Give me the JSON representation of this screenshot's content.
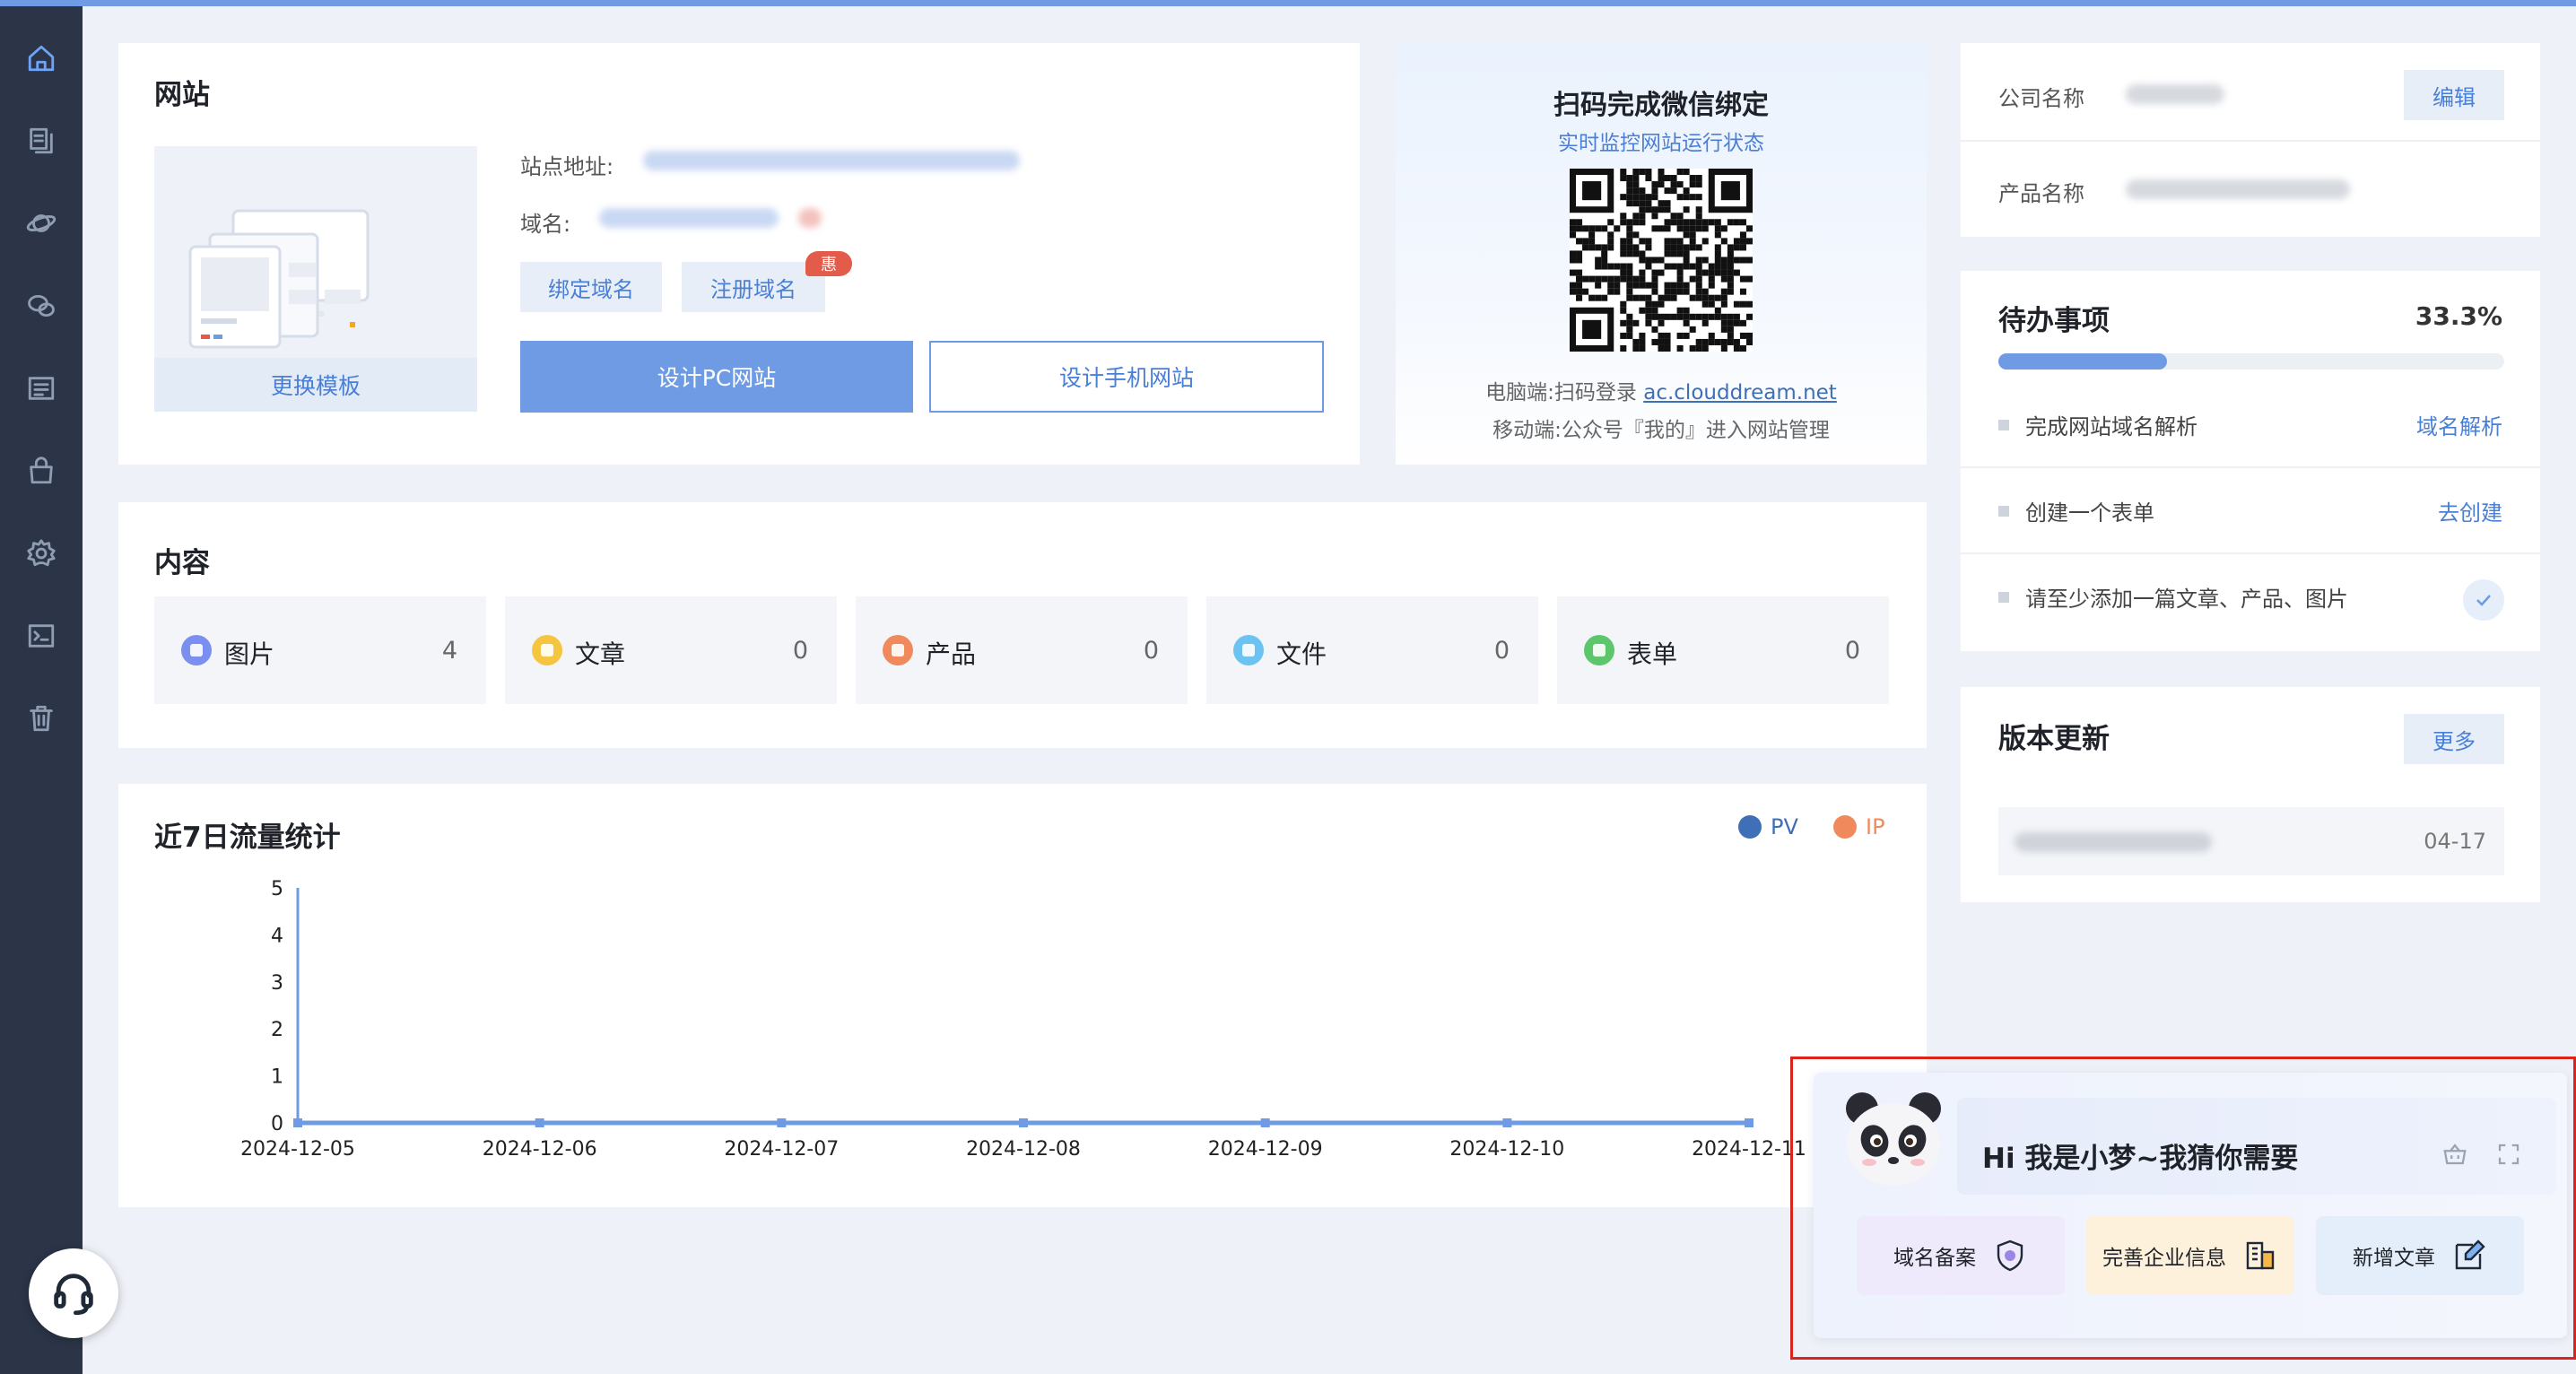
{
  "colors": {
    "accent": "#6e9be4",
    "link": "#4a7fd6",
    "sidebar": "#2b3547",
    "pv": "#3f6fb6",
    "ip": "#f08a5d"
  },
  "sidebar": {
    "items": [
      {
        "icon": "home-icon"
      },
      {
        "icon": "pages-icon"
      },
      {
        "icon": "planet-icon"
      },
      {
        "icon": "wechat-icon"
      },
      {
        "icon": "list-icon"
      },
      {
        "icon": "shop-icon"
      },
      {
        "icon": "gear-icon"
      },
      {
        "icon": "terminal-icon"
      },
      {
        "icon": "trash-icon"
      }
    ]
  },
  "website": {
    "title": "网站",
    "change_template": "更换模板",
    "site_address_label": "站点地址:",
    "domain_label": "域名:",
    "bind_domain": "绑定域名",
    "register_domain": "注册域名",
    "hui_badge": "惠",
    "design_pc": "设计PC网站",
    "design_mobile": "设计手机网站"
  },
  "wechat": {
    "title": "扫码完成微信绑定",
    "subtitle": "实时监控网站运行状态",
    "pc_label": "电脑端:扫码登录",
    "pc_link": "ac.clouddream.net",
    "mobile_label": "移动端:公众号『我的』进入网站管理"
  },
  "content": {
    "title": "内容",
    "tiles": [
      {
        "label": "图片",
        "count": "4",
        "color": "#7a8ff0"
      },
      {
        "label": "文章",
        "count": "0",
        "color": "#f5c542"
      },
      {
        "label": "产品",
        "count": "0",
        "color": "#f08a5d"
      },
      {
        "label": "文件",
        "count": "0",
        "color": "#6cc3f2"
      },
      {
        "label": "表单",
        "count": "0",
        "color": "#5cc76a"
      }
    ]
  },
  "traffic": {
    "title": "近7日流量统计",
    "legend": [
      {
        "name": "PV",
        "color": "#3f6fb6"
      },
      {
        "name": "IP",
        "color": "#f08a5d"
      }
    ]
  },
  "chart_data": {
    "type": "line",
    "title": "近7日流量统计",
    "x": [
      "2024-12-05",
      "2024-12-06",
      "2024-12-07",
      "2024-12-08",
      "2024-12-09",
      "2024-12-10",
      "2024-12-11"
    ],
    "series": [
      {
        "name": "PV",
        "values": [
          0,
          0,
          0,
          0,
          0,
          0,
          0
        ]
      },
      {
        "name": "IP",
        "values": [
          0,
          0,
          0,
          0,
          0,
          0,
          0
        ]
      }
    ],
    "yticks": [
      "0",
      "1",
      "2",
      "3",
      "4",
      "5"
    ],
    "ylim": [
      0,
      5
    ],
    "legend_position": "top-right"
  },
  "company": {
    "company_label": "公司名称",
    "product_label": "产品名称",
    "edit": "编辑"
  },
  "todo": {
    "title": "待办事项",
    "percent": "33.3%",
    "progress": 0.333,
    "items": [
      {
        "text": "完成网站域名解析",
        "action": "域名解析"
      },
      {
        "text": "创建一个表单",
        "action": "去创建"
      },
      {
        "text": "请至少添加一篇文章、产品、图片",
        "action": ""
      }
    ]
  },
  "version": {
    "title": "版本更新",
    "more": "更多",
    "date": "04-17"
  },
  "assistant": {
    "greeting": "Hi 我是小梦~我猜你需要",
    "actions": [
      {
        "label": "域名备案",
        "icon": "shield-icon",
        "bg": "#efeafb"
      },
      {
        "label": "完善企业信息",
        "icon": "building-icon",
        "bg": "#fdf1dc"
      },
      {
        "label": "新增文章",
        "icon": "edit-doc-icon",
        "bg": "#e4eefb"
      }
    ]
  }
}
